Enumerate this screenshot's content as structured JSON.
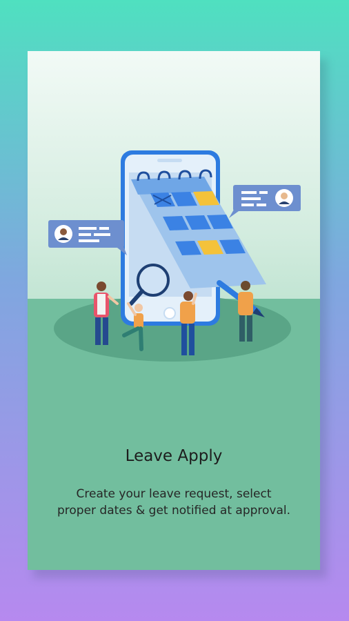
{
  "onboarding": {
    "illustration": "calendar-leave-illustration",
    "title": "Leave Apply",
    "description": "Create your leave request, select proper dates & get notified at approval."
  },
  "colors": {
    "background_top": "#4fe0c0",
    "background_bottom": "#b689ef",
    "floor": "#72be9e",
    "accent_blue": "#2d7be0",
    "accent_yellow": "#f4c23a"
  }
}
